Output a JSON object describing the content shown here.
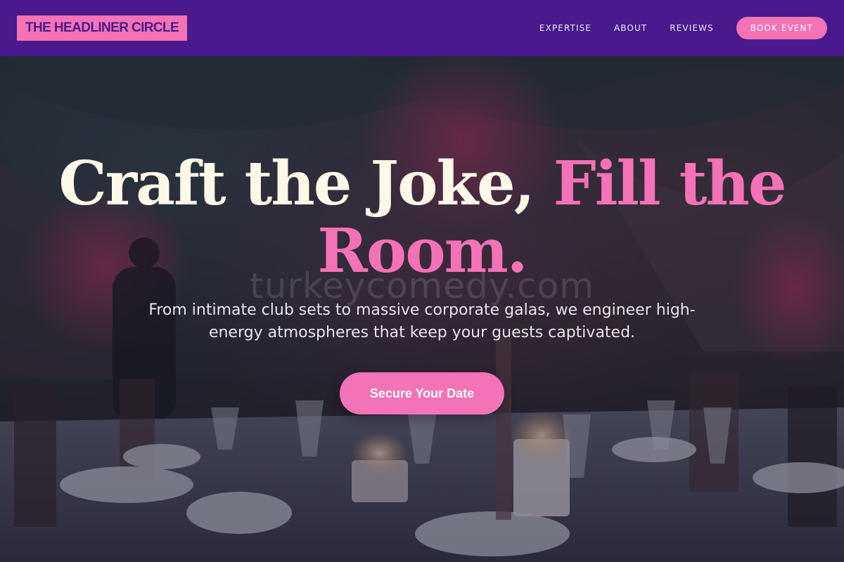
{
  "brand": {
    "name": "THE HEADLINER CIRCLE"
  },
  "nav": {
    "links": [
      "EXPERTISE",
      "ABOUT",
      "REVIEWS"
    ],
    "cta_label": "BOOK EVENT"
  },
  "hero": {
    "title_part1": "Craft the Joke, ",
    "title_part2": "Fill the Room.",
    "watermark": "turkeycomedy.com",
    "subtitle": "From intimate club sets to massive corporate galas, we engineer high-energy atmospheres that keep your guests captivated.",
    "cta_label": "Secure Your Date"
  },
  "colors": {
    "nav_background": "#4a1a8c",
    "accent_pink": "#f472b6",
    "title_cream": "#fdf8e8"
  }
}
